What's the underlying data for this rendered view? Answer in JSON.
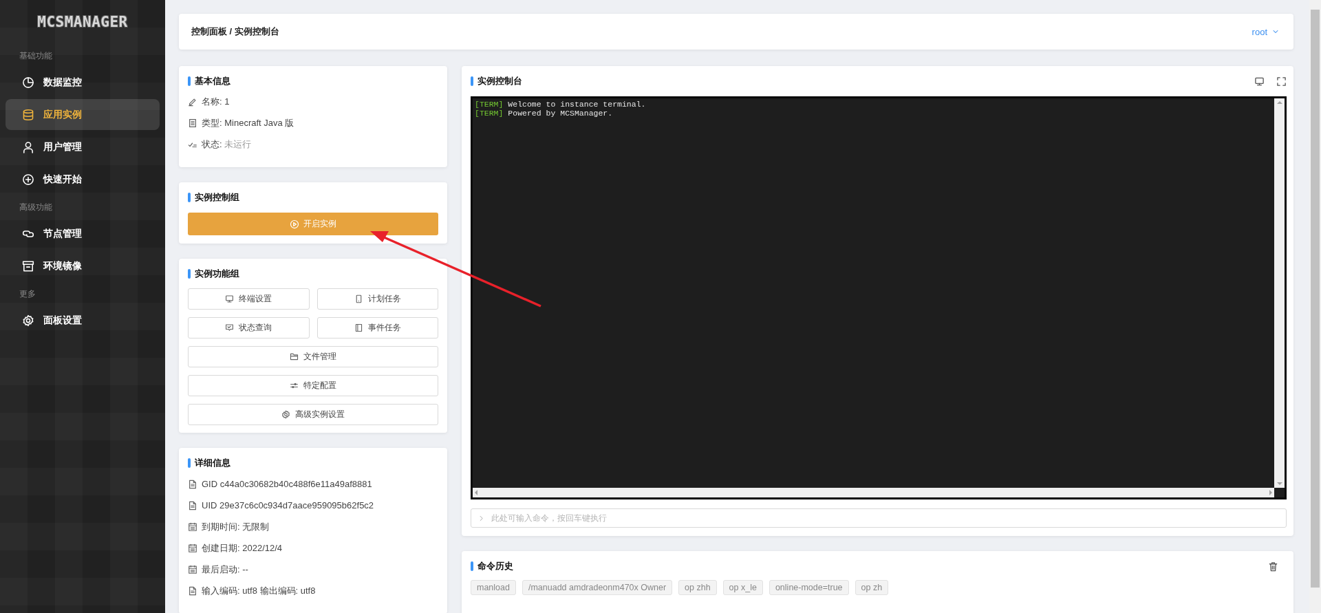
{
  "sidebar": {
    "logo": "MCSMANAGER",
    "groups": [
      {
        "title": "基础功能",
        "items": [
          {
            "label": "数据监控",
            "selected": false
          },
          {
            "label": "应用实例",
            "selected": true
          },
          {
            "label": "用户管理",
            "selected": false
          },
          {
            "label": "快速开始",
            "selected": false
          }
        ]
      },
      {
        "title": "高级功能",
        "items": [
          {
            "label": "节点管理",
            "selected": false
          },
          {
            "label": "环境镜像",
            "selected": false
          }
        ]
      },
      {
        "title": "更多",
        "items": [
          {
            "label": "面板设置",
            "selected": false
          }
        ]
      }
    ]
  },
  "header": {
    "breadcrumb": "控制面板 / 实例控制台",
    "user": "root"
  },
  "basic_info": {
    "title": "基本信息",
    "rows": [
      "名称: 1",
      "类型: Minecraft Java 版"
    ],
    "status": {
      "label": "状态: ",
      "value": "未运行",
      "running": false
    }
  },
  "control_group": {
    "title": "实例控制组",
    "start_button": "开启实例"
  },
  "function_group": {
    "title": "实例功能组",
    "buttons": [
      "终端设置",
      "计划任务",
      "状态查询",
      "事件任务",
      "文件管理",
      "特定配置",
      "高级实例设置"
    ]
  },
  "details": {
    "title": "详细信息",
    "rows": [
      "GID c44a0c30682b40c488f6e11a49af8881",
      "UID 29e37c6c0c934d7aace959095b62f5c2",
      "到期时间: 无限制",
      "创建日期: 2022/12/4",
      "最后启动: --",
      "输入编码: utf8 输出编码: utf8"
    ]
  },
  "console": {
    "title": "实例控制台",
    "lines": [
      {
        "tag": "[TERM]",
        "text": "Welcome to instance terminal."
      },
      {
        "tag": "[TERM]",
        "text": "Powered by MCSManager."
      }
    ],
    "input": {
      "placeholder": "此处可输入命令，按回车键执行"
    }
  },
  "history": {
    "title": "命令历史",
    "commands": [
      "manload",
      "/manuadd amdradeonm470x Owner",
      "op zhh",
      "op x_le",
      "online-mode=true",
      "op zh"
    ]
  }
}
